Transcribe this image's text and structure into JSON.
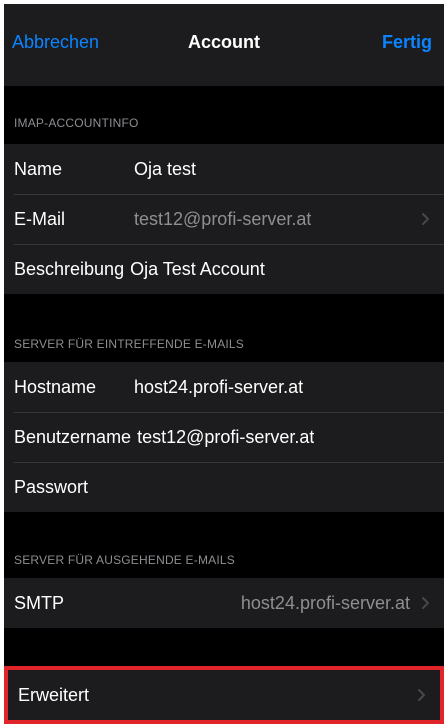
{
  "nav": {
    "cancel_label": "Abbrechen",
    "title": "Account",
    "done_label": "Fertig"
  },
  "sections": {
    "imap": {
      "header": "IMAP-ACCOUNTINFO",
      "name_label": "Name",
      "name_value": "Oja test",
      "email_label": "E-Mail",
      "email_value": "test12@profi-server.at",
      "description_label": "Beschreibung",
      "description_value": "Oja Test Account"
    },
    "incoming": {
      "header": "SERVER FÜR EINTREFFENDE E-MAILS",
      "hostname_label": "Hostname",
      "hostname_value": "host24.profi-server.at",
      "username_label": "Benutzername",
      "username_value": "test12@profi-server.at",
      "password_label": "Passwort"
    },
    "outgoing": {
      "header": "SERVER FÜR AUSGEHENDE E-MAILS",
      "smtp_label": "SMTP",
      "smtp_value": "host24.profi-server.at"
    },
    "advanced": {
      "label": "Erweitert"
    }
  },
  "colors": {
    "accent": "#0a84ff",
    "highlight_border": "#e0242a",
    "background": "#000000",
    "cell": "#1c1c1e",
    "secondary_text": "#8e8e93"
  },
  "icons": {
    "chevron": "chevron-right-icon"
  }
}
